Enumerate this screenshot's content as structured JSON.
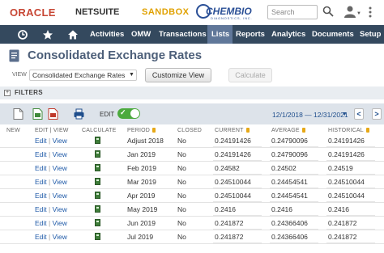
{
  "brand": {
    "oracle": "ORACLE",
    "netsuite": "NETSUITE",
    "sandbox": "SANDBOX",
    "partner_logo": "CHEMBIO",
    "partner_sub": "DIAGNOSTICS, INC."
  },
  "search": {
    "placeholder": "Search"
  },
  "nav": {
    "items": [
      {
        "label": "Activities"
      },
      {
        "label": "OMW"
      },
      {
        "label": "Transactions"
      },
      {
        "label": "Lists",
        "active": true
      },
      {
        "label": "Reports"
      },
      {
        "label": "Analytics"
      },
      {
        "label": "Documents"
      },
      {
        "label": "Setup"
      }
    ],
    "icons": [
      "recent-icon",
      "star-icon",
      "home-icon"
    ]
  },
  "page": {
    "title": "Consolidated Exchange Rates"
  },
  "view": {
    "label": "VIEW",
    "selected": "Consolidated Exchange Rates",
    "customize_label": "Customize View",
    "calculate_label": "Calculate"
  },
  "filters": {
    "label": "FILTERS",
    "toggle": "+"
  },
  "toolbar": {
    "edit_label": "EDIT",
    "date_range": "12/1/2018 — 12/31/2021",
    "prev": "<",
    "next": ">"
  },
  "table": {
    "headers": {
      "new": "NEW",
      "edit_view": "EDIT | VIEW",
      "calculate": "CALCULATE",
      "period": "PERIOD",
      "closed": "CLOSED",
      "current": "CURRENT",
      "average": "AVERAGE",
      "historical": "HISTORICAL"
    },
    "edit": "Edit",
    "view": "View",
    "sep": "|",
    "rows": [
      {
        "period": "Adjust 2018",
        "closed": "No",
        "current": "0.24191426",
        "average": "0.24790096",
        "historical": "0.24191426"
      },
      {
        "period": "Jan 2019",
        "closed": "No",
        "current": "0.24191426",
        "average": "0.24790096",
        "historical": "0.24191426"
      },
      {
        "period": "Feb 2019",
        "closed": "No",
        "current": "0.24582",
        "average": "0.24502",
        "historical": "0.24519"
      },
      {
        "period": "Mar 2019",
        "closed": "No",
        "current": "0.24510044",
        "average": "0.24454541",
        "historical": "0.24510044"
      },
      {
        "period": "Apr 2019",
        "closed": "No",
        "current": "0.24510044",
        "average": "0.24454541",
        "historical": "0.24510044"
      },
      {
        "period": "May 2019",
        "closed": "No",
        "current": "0.2416",
        "average": "0.2416",
        "historical": "0.2416"
      },
      {
        "period": "Jun 2019",
        "closed": "No",
        "current": "0.241872",
        "average": "0.24366406",
        "historical": "0.241872"
      },
      {
        "period": "Jul 2019",
        "closed": "No",
        "current": "0.241872",
        "average": "0.24366406",
        "historical": "0.241872"
      }
    ]
  }
}
